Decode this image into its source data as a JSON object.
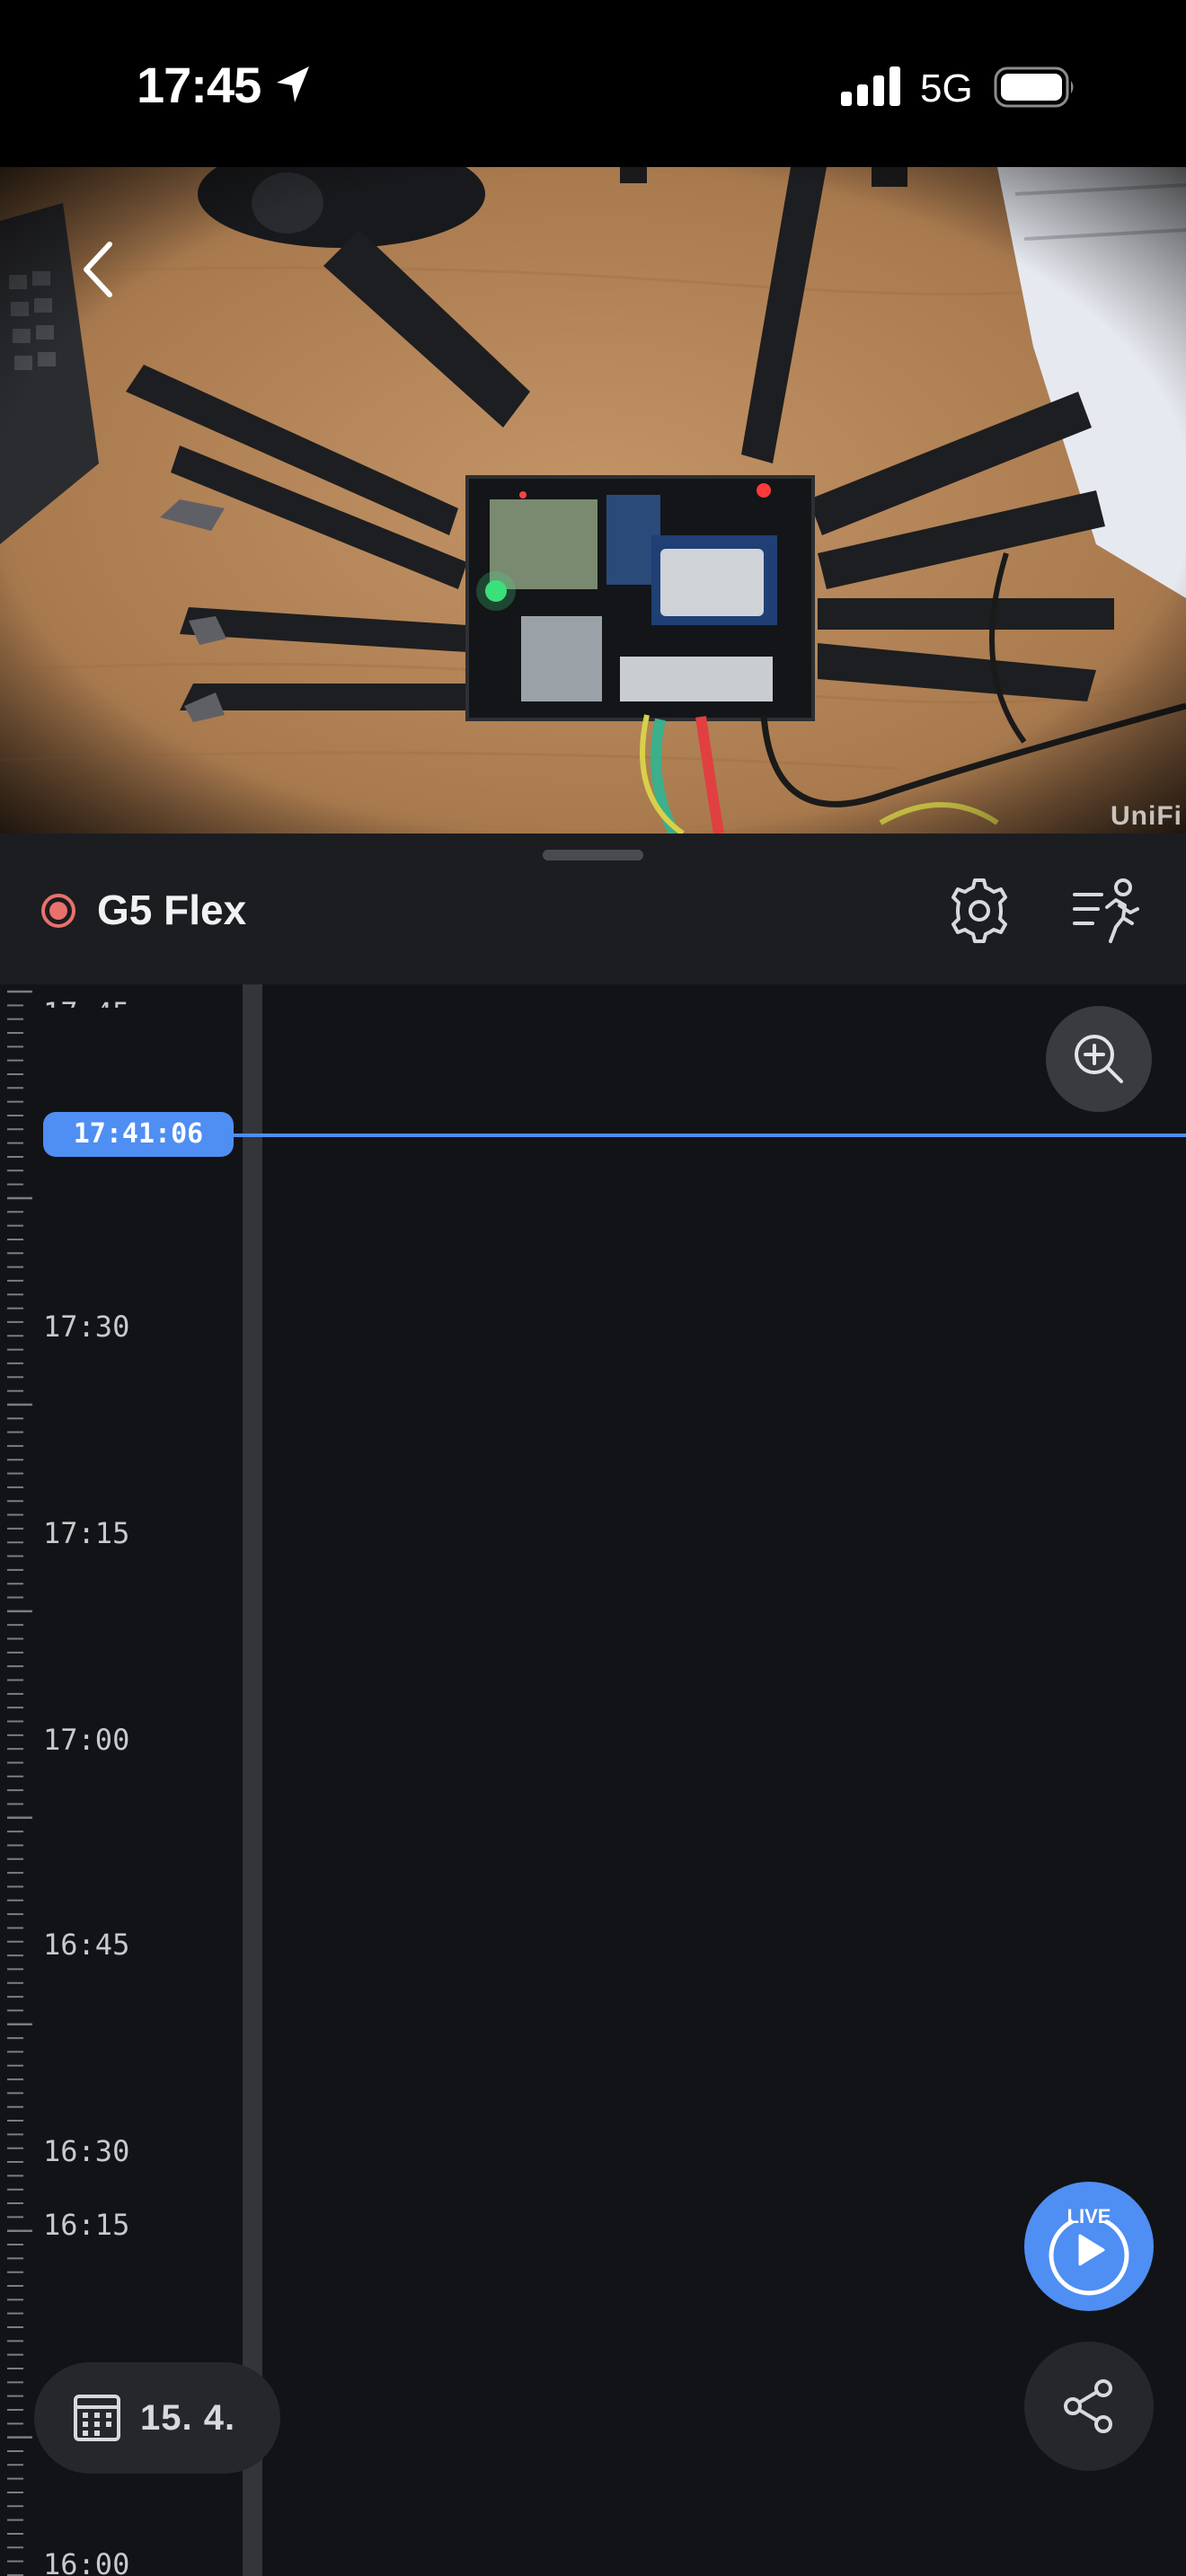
{
  "status_bar": {
    "time": "17:45",
    "network": "5G",
    "icons": [
      "location-arrow-icon",
      "signal-icon",
      "battery-icon"
    ]
  },
  "video": {
    "watermark": "UniFi",
    "back_icon": "chevron-left-icon"
  },
  "camera": {
    "name": "G5 Flex",
    "status_color": "#e8716c",
    "icons": [
      "gear-icon",
      "motion-filter-icon"
    ]
  },
  "timeline": {
    "playhead_time": "17:41:06",
    "labels": [
      "17:30",
      "17:15",
      "17:00",
      "16:45",
      "16:30",
      "16:15",
      "16:00"
    ],
    "accent_color": "#4f8ef3",
    "zoom_icon": "zoom-in-icon"
  },
  "controls": {
    "live_label": "LIVE",
    "date_label": "15. 4.",
    "icons": [
      "play-icon",
      "share-icon",
      "calendar-icon"
    ]
  }
}
